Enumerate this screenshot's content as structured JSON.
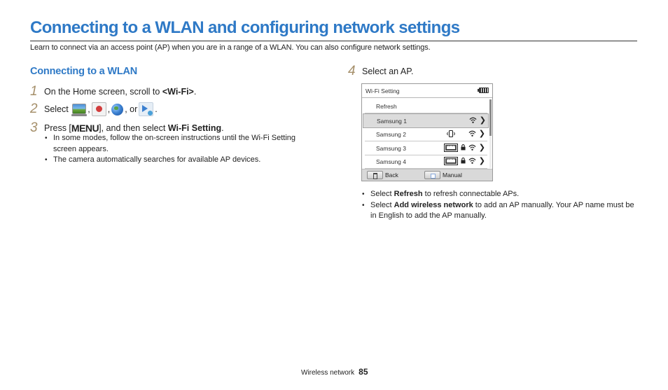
{
  "page": {
    "title": "Connecting to a WLAN and configuring network settings",
    "intro": "Learn to connect via an access point (AP) when you are in a range of a WLAN. You can also configure network settings."
  },
  "section": {
    "heading": "Connecting to a WLAN"
  },
  "steps": [
    {
      "num": "1",
      "text_before": "On the Home screen, scroll to ",
      "bold": "<Wi-Fi>",
      "text_after": "."
    },
    {
      "num": "2",
      "text_before": "Select ",
      "sep1": ",",
      "sep2": ",",
      "sep3": ", or",
      "text_after": ".",
      "icons": [
        "photo-beaming-icon",
        "email-icon",
        "sns-cloud-icon",
        "allshare-play-icon"
      ]
    },
    {
      "num": "3",
      "text_before": "Press [",
      "menu_key": "MENU",
      "text_mid": "], and then select ",
      "bold": "Wi-Fi Setting",
      "text_after": ".",
      "bullets": [
        "In some modes, follow the on-screen instructions until the Wi-Fi Setting screen appears.",
        "The camera automatically searches for available AP devices."
      ]
    },
    {
      "num": "4",
      "text": "Select an AP."
    }
  ],
  "camera_screen": {
    "title": "Wi-Fi Setting",
    "battery": "full",
    "rows": [
      {
        "label": "Refresh",
        "selected": false,
        "icons": []
      },
      {
        "label": "Samsung 1",
        "selected": true,
        "icons": [
          "wifi-signal",
          "chevron-right"
        ]
      },
      {
        "label": "Samsung 2",
        "selected": false,
        "icons": [
          "vibrate-ad-hoc",
          "wifi-signal",
          "chevron-right"
        ]
      },
      {
        "label": "Samsung 3",
        "selected": false,
        "icons": [
          "wps",
          "lock",
          "wifi-signal",
          "chevron-right"
        ]
      },
      {
        "label": "Samsung 4",
        "selected": false,
        "icons": [
          "wps",
          "lock",
          "wifi-signal",
          "chevron-right"
        ]
      }
    ],
    "wps_label": "WPS",
    "chevron": "❯",
    "footer": {
      "back_label": "Back",
      "manual_label": "Manual"
    }
  },
  "notes": [
    {
      "before": "Select ",
      "bold": "Refresh",
      "after": " to refresh connectable APs."
    },
    {
      "before": "Select ",
      "bold": "Add wireless network",
      "after": " to add an AP manually. Your AP name must be in English to add the AP manually."
    }
  ],
  "footer": {
    "section": "Wireless network",
    "page_number": "85"
  },
  "colors": {
    "heading_blue": "#2e79c6",
    "step_number": "#a58f6a"
  }
}
